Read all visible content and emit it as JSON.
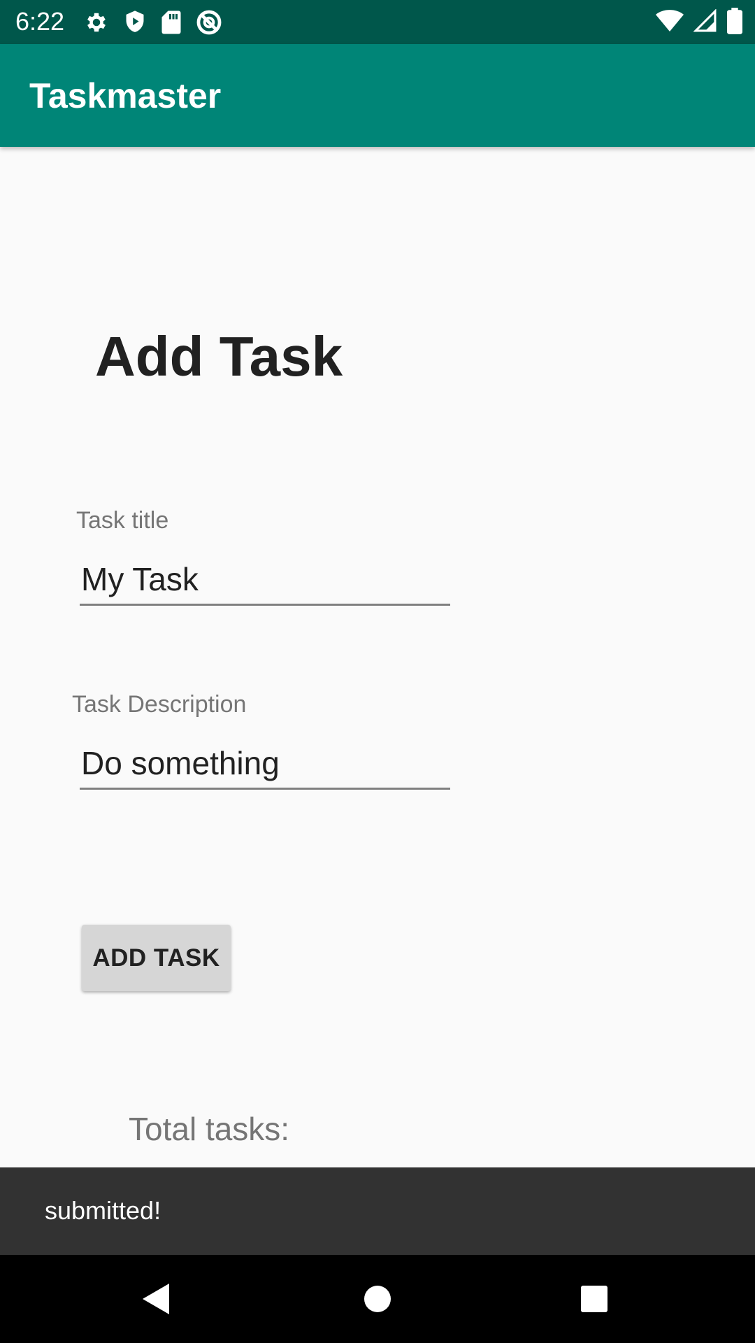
{
  "status_bar": {
    "time": "6:22",
    "icons_left": [
      "settings-icon",
      "shield-icon",
      "sd-card-icon",
      "do-not-disturb-icon"
    ],
    "icons_right": [
      "wifi-icon",
      "signal-icon",
      "battery-icon"
    ]
  },
  "app_bar": {
    "title": "Taskmaster",
    "color": "#008577"
  },
  "main": {
    "heading": "Add Task",
    "task_title": {
      "label": "Task title",
      "value": "My Task"
    },
    "task_description": {
      "label": "Task Description",
      "value": "Do something"
    },
    "add_button_label": "ADD TASK",
    "total_tasks_label": "Total tasks:"
  },
  "snackbar": {
    "message": "submitted!"
  },
  "nav_bar": {
    "buttons": [
      "back-icon",
      "home-icon",
      "recents-icon"
    ]
  }
}
